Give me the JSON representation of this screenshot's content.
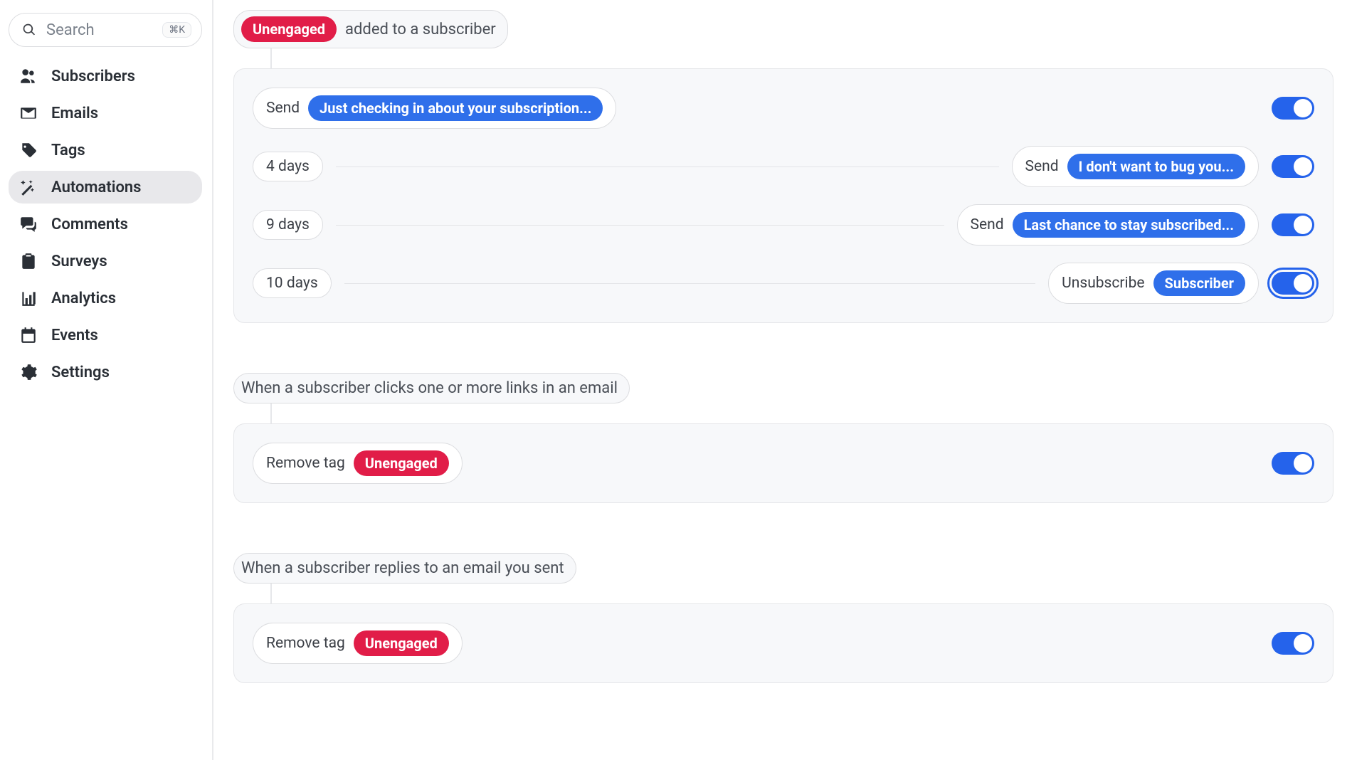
{
  "sidebar": {
    "search_placeholder": "Search",
    "search_shortcut": "⌘K",
    "items": [
      {
        "label": "Subscribers",
        "icon": "users"
      },
      {
        "label": "Emails",
        "icon": "envelope"
      },
      {
        "label": "Tags",
        "icon": "tag"
      },
      {
        "label": "Automations",
        "icon": "wand",
        "active": true
      },
      {
        "label": "Comments",
        "icon": "comments"
      },
      {
        "label": "Surveys",
        "icon": "clipboard"
      },
      {
        "label": "Analytics",
        "icon": "chart"
      },
      {
        "label": "Events",
        "icon": "calendar"
      },
      {
        "label": "Settings",
        "icon": "gear"
      }
    ]
  },
  "automations": [
    {
      "trigger": {
        "tag": "Unengaged",
        "text": "added to a subscriber"
      },
      "steps": [
        {
          "type": "send",
          "left_label": null,
          "action": "Send",
          "email": "Just checking in about your subscription...",
          "toggle": true,
          "focused": false
        },
        {
          "type": "send",
          "left_label": "4 days",
          "action": "Send",
          "email": "I don't want to bug you...",
          "toggle": true,
          "focused": false
        },
        {
          "type": "send",
          "left_label": "9 days",
          "action": "Send",
          "email": "Last chance to stay subscribed...",
          "toggle": true,
          "focused": false
        },
        {
          "type": "unsub",
          "left_label": "10 days",
          "action": "Unsubscribe",
          "pill": "Subscriber",
          "toggle": true,
          "focused": true
        }
      ]
    },
    {
      "trigger": {
        "text": "When a subscriber clicks one or more links in an email"
      },
      "steps": [
        {
          "type": "remove_tag",
          "action": "Remove tag",
          "tag": "Unengaged",
          "toggle": true,
          "focused": false
        }
      ]
    },
    {
      "trigger": {
        "text": "When a subscriber replies to an email you sent"
      },
      "steps": [
        {
          "type": "remove_tag",
          "action": "Remove tag",
          "tag": "Unengaged",
          "toggle": true,
          "focused": false
        }
      ]
    }
  ]
}
